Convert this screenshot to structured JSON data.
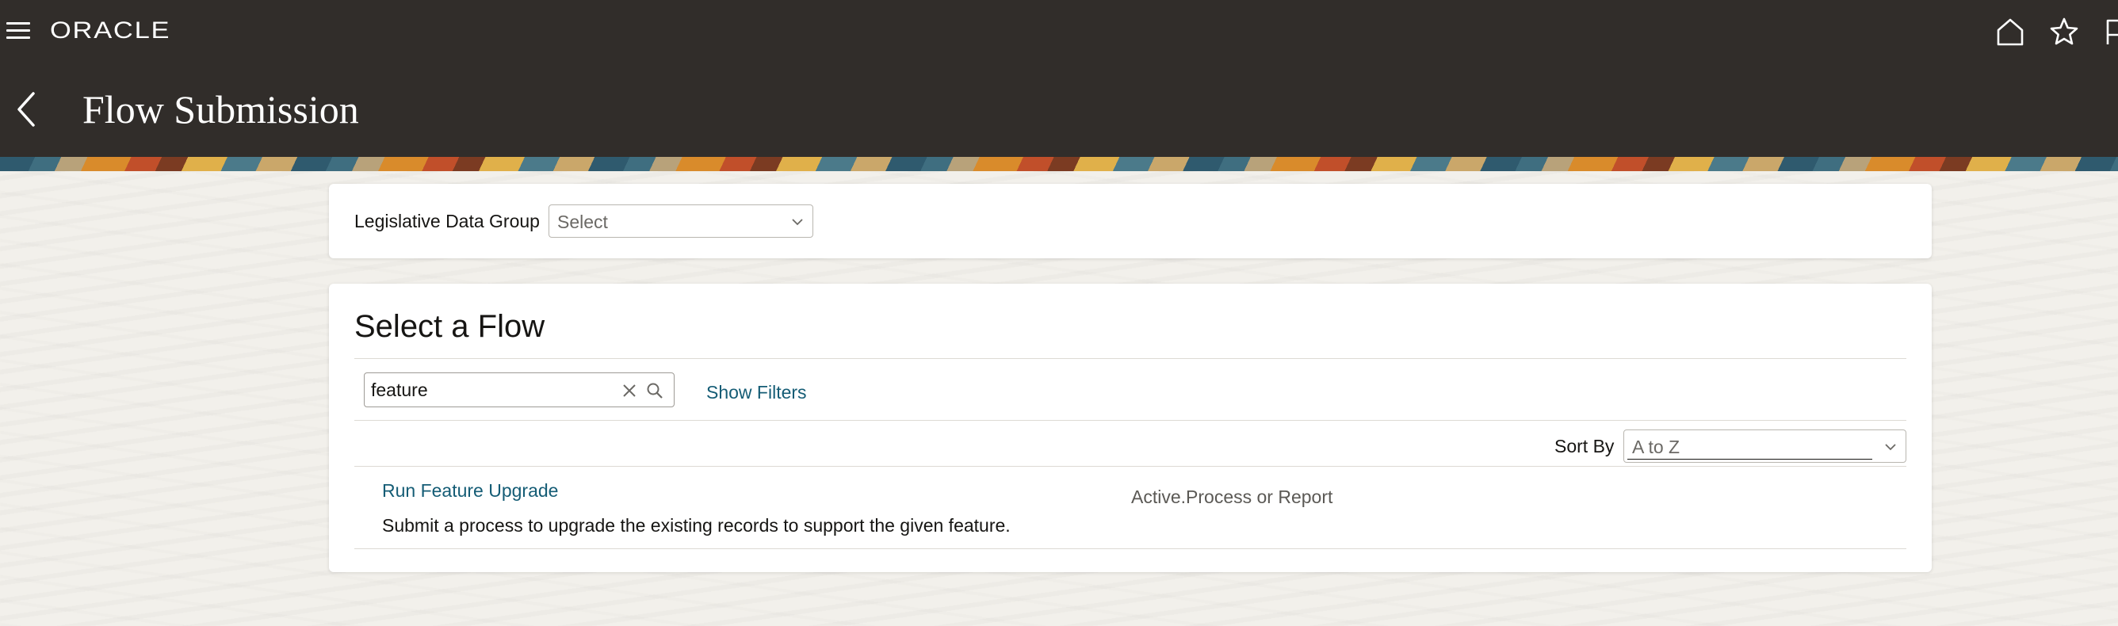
{
  "app": {
    "brand": "ORACLE",
    "page_title": "Flow Submission"
  },
  "header_icons": [
    "home-icon",
    "star-icon",
    "flag-icon"
  ],
  "colors": {
    "header_bg": "#312d2a",
    "link": "#145c75",
    "text": "#161513"
  },
  "ldg": {
    "label": "Legislative Data Group",
    "value": "Select"
  },
  "flow_section": {
    "title": "Select a Flow",
    "search_value": "feature",
    "show_filters": "Show Filters",
    "sort_label": "Sort By",
    "sort_value": "A to Z",
    "results": [
      {
        "name": "Run Feature Upgrade",
        "status": "Active.Process or Report",
        "description": "Submit a process to upgrade the existing records to support the given feature."
      }
    ]
  }
}
